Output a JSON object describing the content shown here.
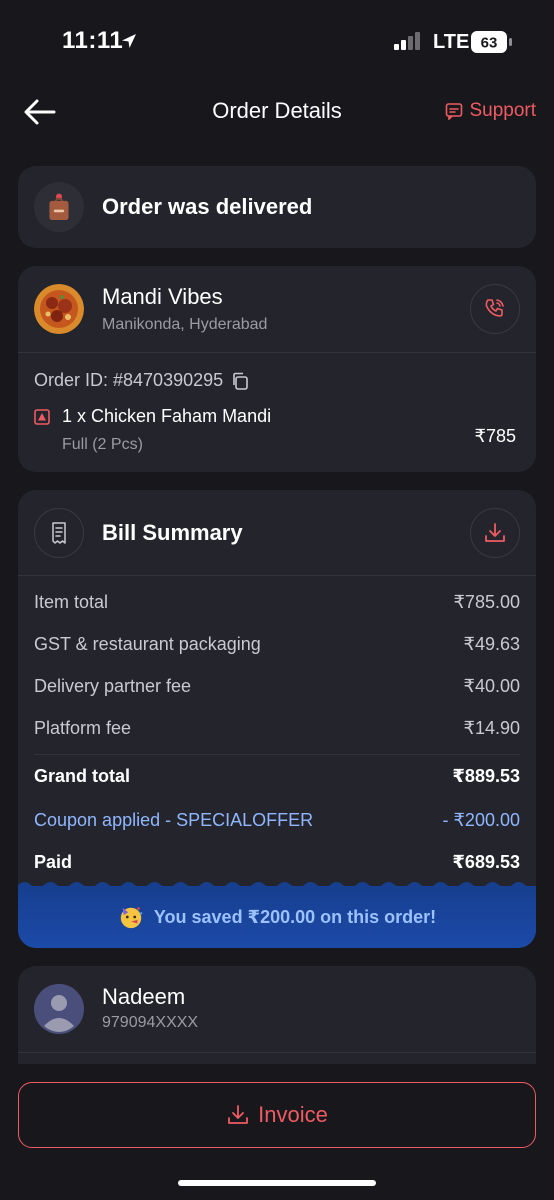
{
  "status_bar": {
    "time": "11:11",
    "carrier": "LTE",
    "battery": "63"
  },
  "header": {
    "title": "Order Details",
    "support_label": "Support"
  },
  "order_status": {
    "text": "Order was delivered"
  },
  "restaurant": {
    "name": "Mandi Vibes",
    "location": "Manikonda, Hyderabad",
    "order_id": "Order ID: #8470390295",
    "item": {
      "name": "1 x Chicken Faham Mandi",
      "variant": "Full (2 Pcs)",
      "price": "₹785"
    }
  },
  "bill": {
    "title": "Bill Summary",
    "rows": [
      {
        "label": "Item total",
        "value": "₹785.00"
      },
      {
        "label": "GST & restaurant packaging",
        "value": "₹49.63"
      },
      {
        "label": "Delivery partner fee",
        "value": "₹40.00"
      },
      {
        "label": "Platform fee",
        "value": "₹14.90"
      }
    ],
    "grand_total": {
      "label": "Grand total",
      "value": "₹889.53"
    },
    "coupon": {
      "label": "Coupon applied - SPECIALOFFER",
      "value": "- ₹200.00"
    },
    "paid": {
      "label": "Paid",
      "value": "₹689.53"
    },
    "savings_text": "You saved ₹200.00 on this order!"
  },
  "person": {
    "name": "Nadeem",
    "phone": "979094XXXX"
  },
  "invoice_label": "Invoice",
  "colors": {
    "background": "#17171c",
    "card": "#24252c",
    "accent": "#ef5b62",
    "coupon": "#8fb6ff",
    "savings_bg": "#1c4aa8"
  }
}
